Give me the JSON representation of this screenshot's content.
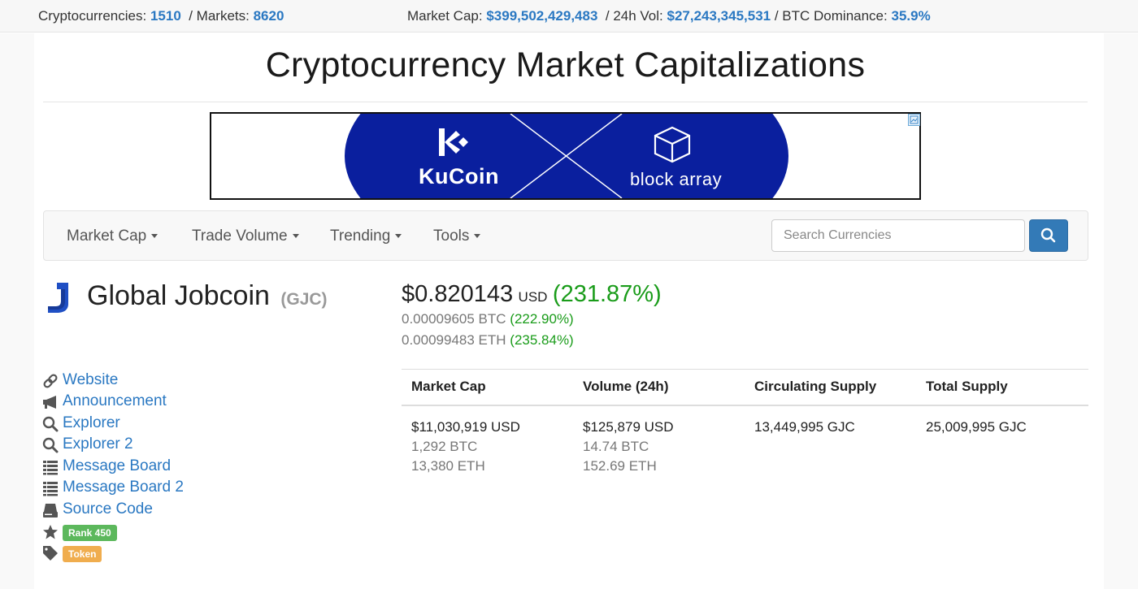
{
  "global": {
    "cryptos_label": "Cryptocurrencies:",
    "cryptos_value": "1510",
    "markets_label": "/ Markets:",
    "markets_value": "8620",
    "mcap_label": "Market Cap:",
    "mcap_value": "$399,502,429,483",
    "vol_label": "/ 24h Vol:",
    "vol_value": "$27,243,345,531",
    "dom_label": "/ BTC Dominance:",
    "dom_value": "35.9%"
  },
  "page_title": "Cryptocurrency Market Capitalizations",
  "banner": {
    "brand_left": "KuCoin",
    "brand_right": "block array",
    "bg_color": "#0a1f9e"
  },
  "nav": {
    "items": [
      {
        "label": "Market Cap"
      },
      {
        "label": "Trade Volume"
      },
      {
        "label": "Trending"
      },
      {
        "label": "Tools"
      }
    ],
    "search_placeholder": "Search Currencies",
    "search_icon": "search-icon"
  },
  "coin": {
    "name": "Global Jobcoin",
    "symbol": "(GJC)",
    "price_usd": "$0.820143",
    "price_currency": "USD",
    "price_change": "(231.87%)",
    "price_btc": "0.00009605 BTC",
    "price_btc_change": "(222.90%)",
    "price_eth": "0.00099483 ETH",
    "price_eth_change": "(235.84%)",
    "logo_color": "#1f4fc4"
  },
  "links": [
    {
      "label": "Website",
      "icon": "link-icon"
    },
    {
      "label": "Announcement",
      "icon": "bullhorn-icon"
    },
    {
      "label": "Explorer",
      "icon": "search-icon"
    },
    {
      "label": "Explorer 2",
      "icon": "search-icon"
    },
    {
      "label": "Message Board",
      "icon": "list-icon"
    },
    {
      "label": "Message Board 2",
      "icon": "list-icon"
    },
    {
      "label": "Source Code",
      "icon": "hdd-icon"
    }
  ],
  "badges": {
    "rank": "Rank 450",
    "rank_color": "#5cb85c",
    "type": "Token",
    "type_color": "#f0ad4e"
  },
  "stats": {
    "headers": [
      "Market Cap",
      "Volume (24h)",
      "Circulating Supply",
      "Total Supply"
    ],
    "market_cap": [
      "$11,030,919 USD",
      "1,292 BTC",
      "13,380 ETH"
    ],
    "volume": [
      "$125,879 USD",
      "14.74 BTC",
      "152.69 ETH"
    ],
    "circulating_supply": "13,449,995 GJC",
    "total_supply": "25,009,995 GJC"
  }
}
